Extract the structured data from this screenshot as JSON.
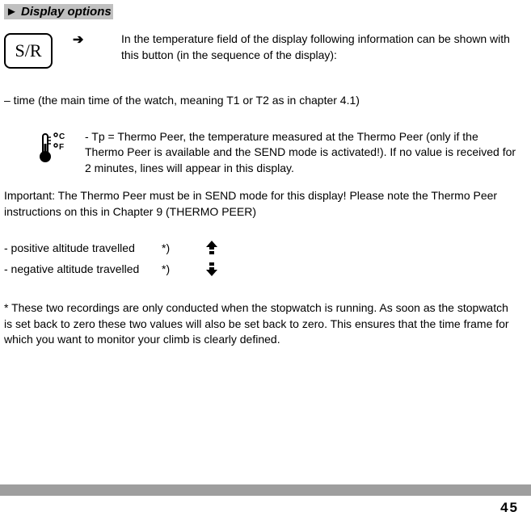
{
  "heading": "► Display options",
  "button": {
    "label": "S/R",
    "arrow": "➔",
    "desc": "In the temperature field of the display following information can be shown with this button (in the sequence of the display):"
  },
  "time_line": "– time (the main time of the watch, meaning T1 or T2 as in chapter 4.1)",
  "tp": {
    "desc": "- Tp = Thermo Peer, the temperature measured at the Thermo Peer (only if the Thermo Peer is available and the SEND mode is activated!). If no value is received for 2 minutes, lines will appear in this display."
  },
  "important": "Important: The Thermo Peer must be in SEND mode for this display! Please note the Thermo Peer instructions on this in Chapter 9 (THERMO PEER)",
  "alt": {
    "pos_label": "- positive altitude travelled",
    "neg_label": "- negative altitude travelled",
    "star": "*)"
  },
  "footnote": "* These two recordings are only conducted when the stopwatch is running. As soon as the stopwatch is set back to zero these two values will also be set back to zero. This ensures that the time frame for which you want to monitor your climb is clearly defined.",
  "page_number": "45"
}
